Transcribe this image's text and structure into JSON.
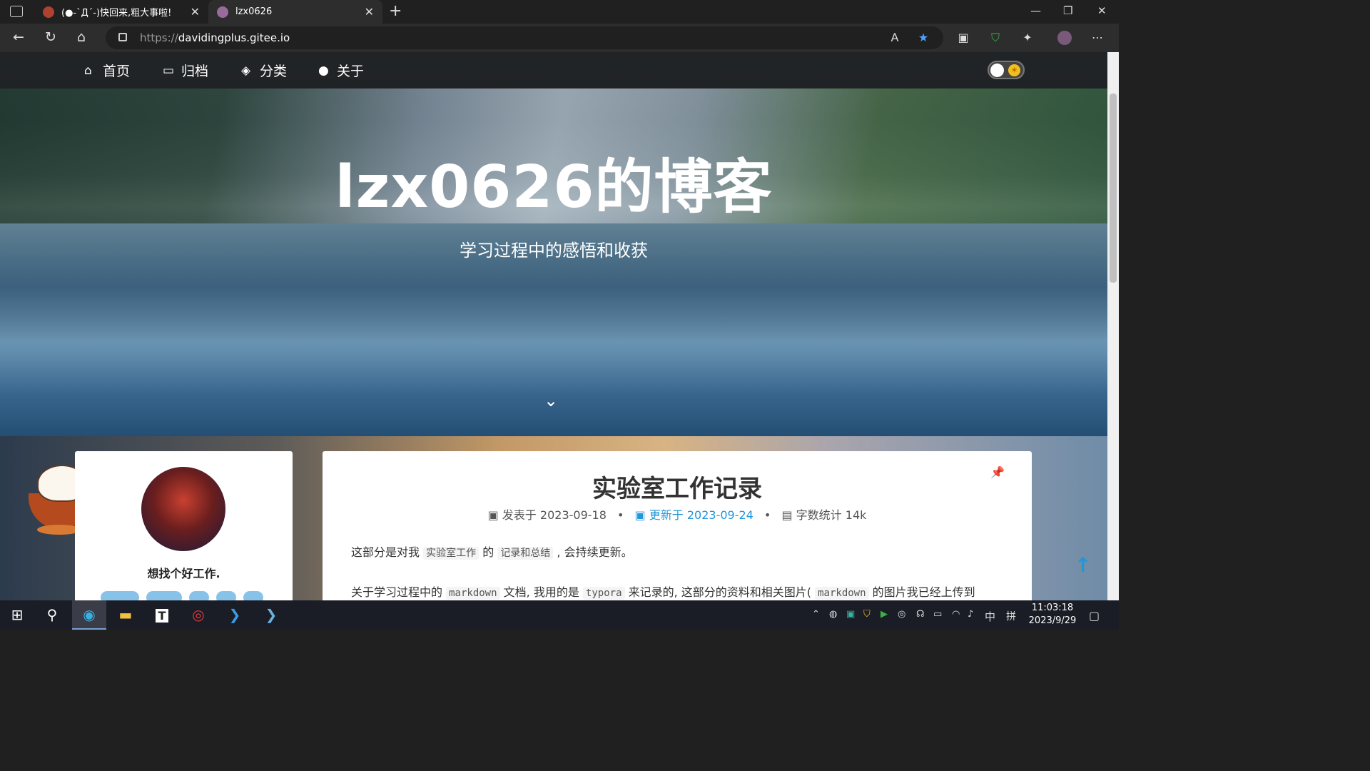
{
  "browser": {
    "tabs": [
      {
        "label": "(●-`Д´-)快回来,粗大事啦!",
        "active": false
      },
      {
        "label": "lzx0626",
        "active": true
      }
    ],
    "url_prefix": "https://",
    "url_domain": "davidingplus.gitee.io"
  },
  "nav": {
    "items": [
      {
        "label": "首页",
        "icon": "home-icon"
      },
      {
        "label": "归档",
        "icon": "folder-icon"
      },
      {
        "label": "分类",
        "icon": "layers-icon"
      },
      {
        "label": "关于",
        "icon": "user-icon"
      }
    ]
  },
  "hero": {
    "title": "lzx0626的博客",
    "subtitle": "学习过程中的感悟和收获"
  },
  "profile": {
    "motto": "想找个好工作."
  },
  "post": {
    "title": "实验室工作记录",
    "published_label": "发表于",
    "published_date": "2023-09-18",
    "updated_label": "更新于",
    "updated_date": "2023-09-24",
    "words_label": "字数统计",
    "words_count": "14k",
    "para1_a": "这部分是对我",
    "para1_code1": "实验室工作",
    "para1_b": "的",
    "para1_code2": "记录和总结",
    "para1_c": ", 会持续更新。",
    "para2_a": "关于学习过程中的",
    "para2_code1": "markdown",
    "para2_b": "文档, 我用的是",
    "para2_code2": "typora",
    "para2_c": "来记录的, 这部分的资料和相关图片(",
    "para2_code3": "markdown",
    "para2_d": "的图片我已经上传到"
  },
  "taskbar": {
    "time": "11:03:18",
    "date": "2023/9/29",
    "ime": "中",
    "ime2": "拼"
  },
  "colors": {
    "accent": "#2196d8",
    "nav_bg": "#1e1e1e",
    "taskbar": "#1a1d26"
  }
}
